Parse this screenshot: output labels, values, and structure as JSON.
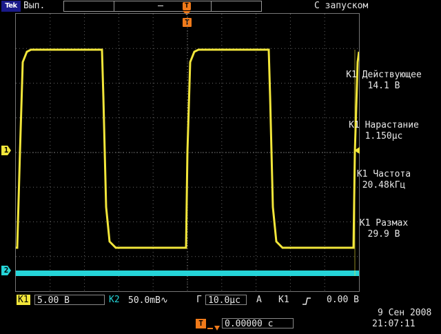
{
  "top_bar": {
    "brand": "Tek",
    "acquisition_mode": "Вып.",
    "trigger_state": "С запуском"
  },
  "channel_markers": {
    "ch1": "1",
    "ch2": "2",
    "trigger": "T"
  },
  "measurements": [
    {
      "label": "К1 Действующее",
      "value": "14.1 В"
    },
    {
      "label": "К1 Нарастание",
      "value": "1.150μс"
    },
    {
      "label": "К1 Частота",
      "value": "20.48kГц"
    },
    {
      "label": "К1 Размах",
      "value": "29.9 В"
    }
  ],
  "bottom_bar": {
    "ch1_label": "К1",
    "ch1_scale": "5.00 В",
    "ch2_label": "К2",
    "ch2_scale": "50.0mВ∿",
    "time_label": "Г",
    "time_scale": "10.0μс",
    "trigger_label": "А",
    "trigger_source": "К1",
    "trigger_slope_icon": "rising-edge",
    "trigger_level": "0.00 В",
    "trigger_position_label": "T",
    "trigger_position": "0.00000 с",
    "date": "9 Сен  2008",
    "time": "21:07:11"
  },
  "colors": {
    "ch1": "#f2e63a",
    "ch2": "#25d4d8",
    "trigger": "#f07a1a",
    "grid": "#6a6a6a"
  }
}
